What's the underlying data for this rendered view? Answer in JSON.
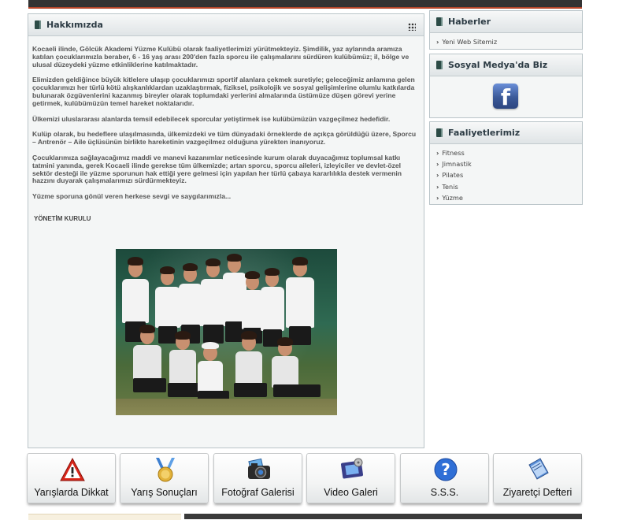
{
  "main": {
    "title": "Hakkımızda",
    "paragraphs": [
      "Kocaeli ilinde, Gölcük Akademi Yüzme Kulübü olarak  faaliyetlerimizi yürütmekteyiz. Şimdilik, yaz aylarında aramıza katılan çocuklarımızla beraber, 6 - 16 yaş arası 200'den fazla sporcu ile çalışmalarını sürdüren kulübümüz; il, bölge ve ulusal düzeydeki yüzme etkinliklerine katılmaktadır.",
      "Elimizden geldiğince büyük kitlelere ulaşıp çocuklarımızı sportif alanlara çekmek suretiyle; geleceğimiz anlamına gelen çocuklarımızı her türlü kötü alışkanlıklardan uzaklaştırmak, fiziksel, psikolojik ve sosyal gelişimlerine olumlu katkılarda bulunarak özgüvenlerini kazanmış bireyler olarak toplumdaki yerlerini almalarında üstümüze düşen görevi yerine getirmek, kulübümüzün temel hareket noktalarıdır.",
      "Ülkemizi uluslararası alanlarda temsil edebilecek sporcular yetiştirmek ise kulübümüzün vazgeçilmez hedefidir.",
      "Kulüp olarak, bu hedeflere ulaşılmasında, ülkemizdeki ve tüm dünyadaki örneklerde de açıkça görüldüğü üzere, Sporcu – Antrenör – Aile üçlüsünün birlikte hareketinin vazgeçilmez olduğuna yürekten inanıyoruz.",
      "Çocuklarımıza sağlayacağımız maddi ve manevi kazanımlar neticesinde kurum olarak duyacağımız toplumsal katkı tatmini yanında, gerek Kocaeli ilinde gerekse tüm ülkemizde; artan sporcu, sporcu aileleri, izleyiciler ve devlet-özel sektör desteği ile yüzme sporunun hak ettiği yere gelmesi için yapılan her türlü çabaya kararlılıkla destek vermenin hazzını duyarak çalışmalarımızı sürdürmekteyiz.",
      "Yüzme sporuna gönül veren herkese sevgi ve saygılarımızla..."
    ],
    "signature": "YÖNETİM KURULU"
  },
  "news": {
    "title": "Haberler",
    "items": [
      "Yeni Web Sitemiz"
    ]
  },
  "social": {
    "title": "Sosyal Medya'da Biz",
    "facebook_glyph": "f"
  },
  "activities": {
    "title": "Faaliyetlerimiz",
    "items": [
      "Fitness",
      "Jimnastik",
      "Pilates",
      "Tenis",
      "Yüzme"
    ]
  },
  "nav_buttons": [
    {
      "label": "Yarışlarda Dikkat",
      "icon": "warning-icon"
    },
    {
      "label": "Yarış Sonuçları",
      "icon": "medal-icon"
    },
    {
      "label": "Fotoğraf Galerisi",
      "icon": "camera-icon"
    },
    {
      "label": "Video Galeri",
      "icon": "film-icon"
    },
    {
      "label": "S.S.S.",
      "icon": "question-icon"
    },
    {
      "label": "Ziyaretçi Defteri",
      "icon": "guestbook-icon"
    }
  ],
  "colors": {
    "header_text": "#2c3b44",
    "accent_red": "#b5462a",
    "facebook_blue": "#3b5998"
  }
}
